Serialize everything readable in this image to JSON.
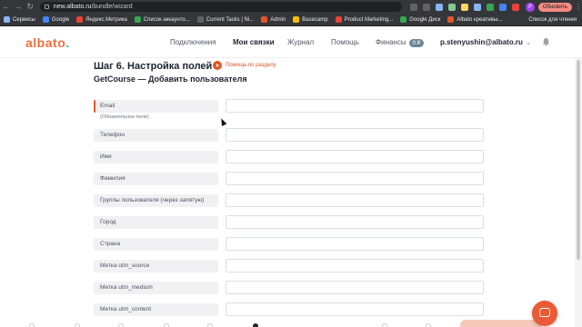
{
  "browser": {
    "url_prefix": "new.albato.ru",
    "url_path": "/bundle/wizard",
    "profile_initial": "P",
    "update_label": "Обновить",
    "back_icon": "arrow-left-icon",
    "forward_icon": "arrow-right-icon",
    "reload_icon": "reload-icon",
    "ext_colors": [
      "#5f6368",
      "#5f6368",
      "#8ab4f8",
      "#81c995",
      "#fdd663",
      "#8ab4f8",
      "#34a853",
      "#4285f4",
      "#ea4335"
    ]
  },
  "bookmarks": {
    "items": [
      {
        "label": "Сервисы",
        "color": "#8ab4f8"
      },
      {
        "label": "Google",
        "color": "#4285f4"
      },
      {
        "label": "Яндекс.Метрика",
        "color": "#ea4335"
      },
      {
        "label": "Список аккаунто...",
        "color": "#34a853"
      },
      {
        "label": "Current Tasks | Ni...",
        "color": "#5f6368"
      },
      {
        "label": "Admin",
        "color": "#e2562a"
      },
      {
        "label": "Basecamp",
        "color": "#fbbc04"
      },
      {
        "label": "Product Marketing...",
        "color": "#ea4335"
      },
      {
        "label": "Google Диск",
        "color": "#34a853"
      },
      {
        "label": "Albato креативы...",
        "color": "#e2562a"
      }
    ],
    "reading_list": "Список для чтения"
  },
  "header": {
    "logo": {
      "a": "a",
      "lb": "lb",
      "rest": "ato",
      "dot": "."
    },
    "nav": {
      "connections": "Подключения",
      "bundles": "Мои связки",
      "journal": "Журнал",
      "help": "Помощь",
      "finance": "Финансы",
      "finance_badge": "0 ₽"
    },
    "user_email": "p.stenyushin@albato.ru",
    "user_chevron": "⌄"
  },
  "wizard": {
    "step_title": "Шаг 6. Настройка полей",
    "help_link": "Помощь по разделу",
    "subtitle": "GetCourse — Добавить пользователя",
    "fields": [
      {
        "label": "Email",
        "hint": "(Обязательное поле)",
        "required": true,
        "value": ""
      },
      {
        "label": "Телефон",
        "value": ""
      },
      {
        "label": "Имя",
        "value": ""
      },
      {
        "label": "Фамилия",
        "value": ""
      },
      {
        "label": "Группы пользователя (через запятую)",
        "value": ""
      },
      {
        "label": "Город",
        "value": ""
      },
      {
        "label": "Страна",
        "value": ""
      },
      {
        "label": "Метка utm_source",
        "value": ""
      },
      {
        "label": "Метка utm_medium",
        "value": ""
      },
      {
        "label": "Метка utm_content",
        "value": ""
      }
    ]
  },
  "colors": {
    "accent": "#e2562a",
    "brand_green": "#29c46b",
    "chat": "#ea5a34"
  }
}
